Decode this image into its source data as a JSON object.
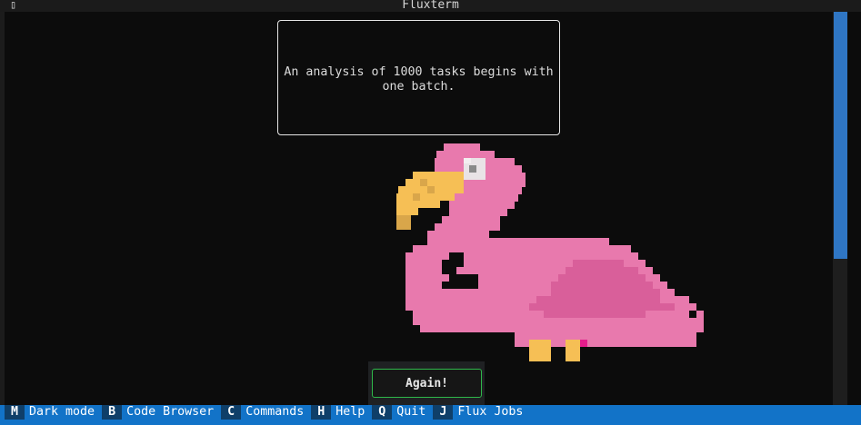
{
  "window": {
    "title": "Fluxterm",
    "icon": "terminal-icon",
    "icon_glyph": "▯"
  },
  "message": {
    "text": "An analysis of 1000 tasks begins with one batch."
  },
  "image": {
    "subject": "pixel-art flamingo",
    "colors": {
      "body": "#e879ad",
      "body_dark": "#d95f9a",
      "beak": "#f6bf55",
      "beak_dark": "#d9a64a",
      "eye": "#e9e3e6",
      "eye_pupil": "#8a8a8a",
      "feet": "#f6bf55",
      "accent": "#e61d8c"
    }
  },
  "again_button": {
    "label": "Again!"
  },
  "footer": {
    "items": [
      {
        "key": "M",
        "label": "Dark mode"
      },
      {
        "key": "B",
        "label": "Code Browser"
      },
      {
        "key": "C",
        "label": "Commands"
      },
      {
        "key": "H",
        "label": "Help"
      },
      {
        "key": "Q",
        "label": "Quit"
      },
      {
        "key": "J",
        "label": "Flux Jobs"
      }
    ]
  },
  "colors": {
    "background": "#0c0c0c",
    "footer_bg": "#1273c8",
    "footer_key_bg": "#0f3f69",
    "scroll_thumb": "#2f76c4",
    "button_border": "#2fb84a"
  }
}
